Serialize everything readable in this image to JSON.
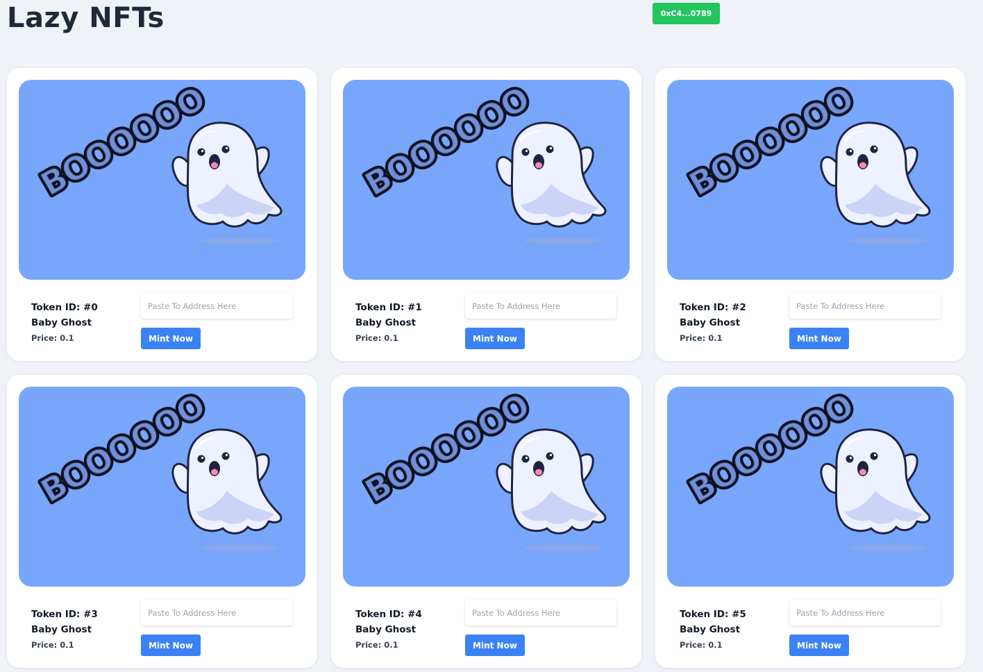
{
  "header": {
    "title": "Lazy NFTs",
    "wallet_label": "0xC4...0789"
  },
  "colors": {
    "background": "#eff2f7",
    "wallet_button": "#22c55e",
    "mint_button": "#3b82f6",
    "image_background": "#78a6fb"
  },
  "cards": [
    {
      "token_label": "Token ID: #0",
      "name": "Baby Ghost",
      "price_label": "Price: 0.1",
      "address_placeholder": "Paste To Address Here",
      "address_value": "",
      "mint_label": "Mint Now",
      "image_text": "BOOOOOO",
      "image_icon": "ghost-illustration"
    },
    {
      "token_label": "Token ID: #1",
      "name": "Baby Ghost",
      "price_label": "Price: 0.1",
      "address_placeholder": "Paste To Address Here",
      "address_value": "",
      "mint_label": "Mint Now",
      "image_text": "BOOOOOO",
      "image_icon": "ghost-illustration"
    },
    {
      "token_label": "Token ID: #2",
      "name": "Baby Ghost",
      "price_label": "Price: 0.1",
      "address_placeholder": "Paste To Address Here",
      "address_value": "",
      "mint_label": "Mint Now",
      "image_text": "BOOOOOO",
      "image_icon": "ghost-illustration"
    },
    {
      "token_label": "Token ID: #3",
      "name": "Baby Ghost",
      "price_label": "Price: 0.1",
      "address_placeholder": "Paste To Address Here",
      "address_value": "",
      "mint_label": "Mint Now",
      "image_text": "BOOOOOO",
      "image_icon": "ghost-illustration"
    },
    {
      "token_label": "Token ID: #4",
      "name": "Baby Ghost",
      "price_label": "Price: 0.1",
      "address_placeholder": "Paste To Address Here",
      "address_value": "",
      "mint_label": "Mint Now",
      "image_text": "BOOOOOO",
      "image_icon": "ghost-illustration"
    },
    {
      "token_label": "Token ID: #5",
      "name": "Baby Ghost",
      "price_label": "Price: 0.1",
      "address_placeholder": "Paste To Address Here",
      "address_value": "",
      "mint_label": "Mint Now",
      "image_text": "BOOOOOO",
      "image_icon": "ghost-illustration"
    }
  ]
}
